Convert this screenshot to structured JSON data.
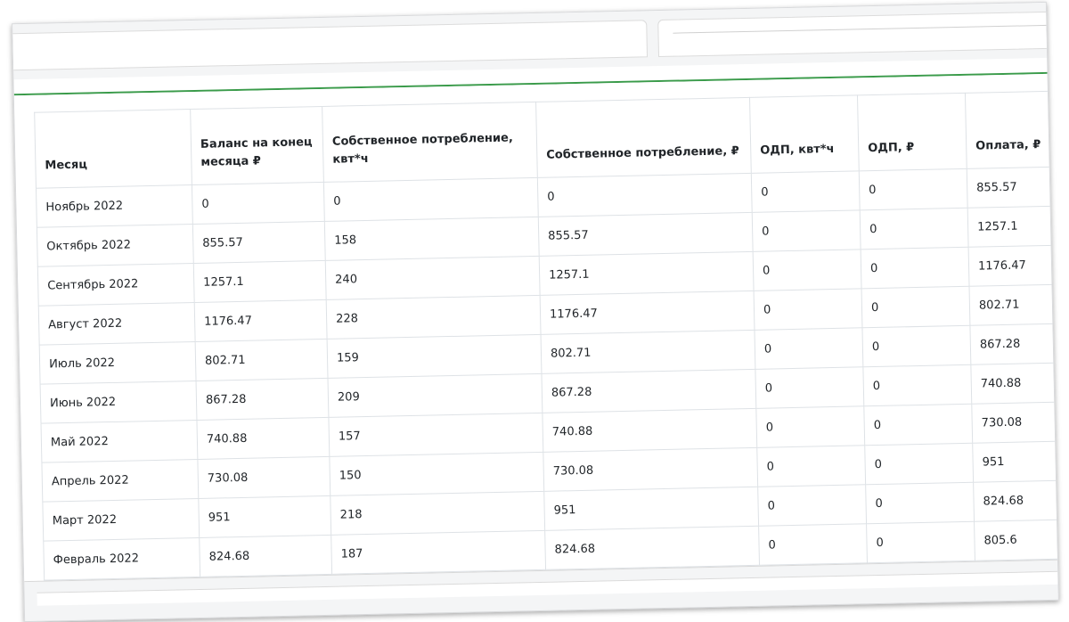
{
  "table": {
    "headers": [
      "Месяц",
      "Баланс на конец месяца ₽",
      "Собственное потребление, квт*ч",
      "Собственное потребление, ₽",
      "ОДП, квт*ч",
      "ОДП, ₽",
      "Оплата, ₽"
    ],
    "rows": [
      [
        "Ноябрь 2022",
        "0",
        "0",
        "0",
        "0",
        "0",
        "855.57"
      ],
      [
        "Октябрь 2022",
        "855.57",
        "158",
        "855.57",
        "0",
        "0",
        "1257.1"
      ],
      [
        "Сентябрь 2022",
        "1257.1",
        "240",
        "1257.1",
        "0",
        "0",
        "1176.47"
      ],
      [
        "Август 2022",
        "1176.47",
        "228",
        "1176.47",
        "0",
        "0",
        "802.71"
      ],
      [
        "Июль 2022",
        "802.71",
        "159",
        "802.71",
        "0",
        "0",
        "867.28"
      ],
      [
        "Июнь 2022",
        "867.28",
        "209",
        "867.28",
        "0",
        "0",
        "740.88"
      ],
      [
        "Май 2022",
        "740.88",
        "157",
        "740.88",
        "0",
        "0",
        "730.08"
      ],
      [
        "Апрель 2022",
        "730.08",
        "150",
        "730.08",
        "0",
        "0",
        "951"
      ],
      [
        "Март 2022",
        "951",
        "218",
        "951",
        "0",
        "0",
        "824.68"
      ],
      [
        "Февраль 2022",
        "824.68",
        "187",
        "824.68",
        "0",
        "0",
        "805.6"
      ]
    ]
  },
  "colors": {
    "accent_line": "#3a9b4a",
    "grid": "#dee2e6",
    "text": "#212529"
  }
}
